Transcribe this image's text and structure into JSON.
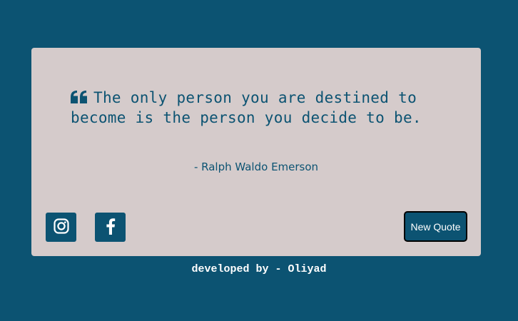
{
  "quote": {
    "text": "The only person you are destined to become is the person you decide to be.",
    "author": "- Ralph Waldo Emerson",
    "icon": "quote-left-icon"
  },
  "social": [
    {
      "name": "instagram",
      "icon": "instagram-icon"
    },
    {
      "name": "facebook",
      "icon": "facebook-icon"
    }
  ],
  "actions": {
    "new_quote_label": "New Quote"
  },
  "footer": {
    "text": "developed by - Oliyad"
  },
  "colors": {
    "background": "#0c5372",
    "card": "#d5cbcb",
    "accent": "#0c5372",
    "text_light": "#ffffff"
  }
}
